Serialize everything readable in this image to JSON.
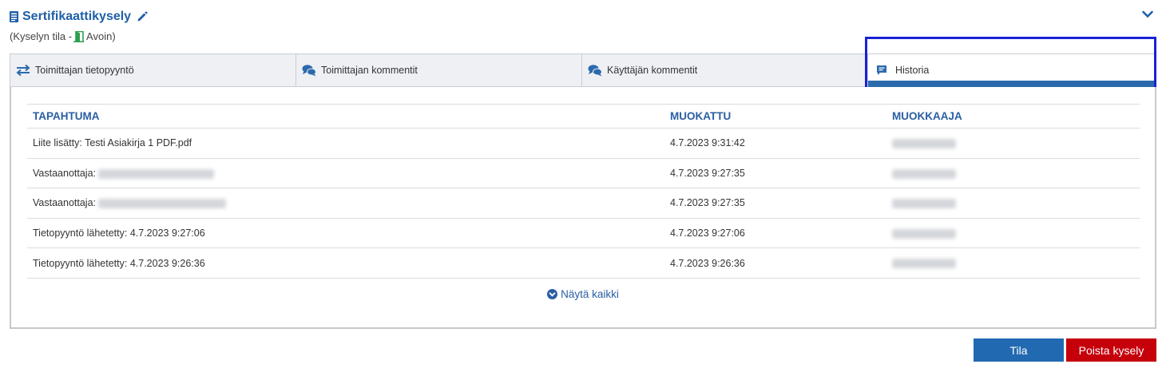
{
  "header": {
    "title": "Sertifikaattikysely",
    "status_prefix": "(Kyselyn tila -",
    "status_value": "Avoin)"
  },
  "tabs": [
    {
      "label": "Toimittajan tietopyyntö",
      "icon": "exchange-arrows-icon",
      "active": false
    },
    {
      "label": "Toimittajan kommentit",
      "icon": "comments-icon",
      "active": false
    },
    {
      "label": "Käyttäjän kommentit",
      "icon": "comments-icon",
      "active": false
    },
    {
      "label": "Historia",
      "icon": "message-icon",
      "active": true
    }
  ],
  "table": {
    "columns": [
      "TAPAHTUMA",
      "MUOKATTU",
      "MUOKKAAJA"
    ],
    "rows": [
      {
        "event": "Liite lisätty: Testi Asiakirja 1 PDF.pdf",
        "modified": "4.7.2023 9:31:42"
      },
      {
        "event": "Vastaanottaja:",
        "modified": "4.7.2023 9:27:35"
      },
      {
        "event": "Vastaanottaja:",
        "modified": "4.7.2023 9:27:35"
      },
      {
        "event": "Tietopyyntö lähetetty: 4.7.2023 9:27:06",
        "modified": "4.7.2023 9:27:06"
      },
      {
        "event": "Tietopyyntö lähetetty: 4.7.2023 9:26:36",
        "modified": "4.7.2023 9:26:36"
      }
    ]
  },
  "show_all": "Näytä kaikki",
  "buttons": {
    "status": "Tila",
    "delete": "Poista kysely"
  },
  "colors": {
    "accent": "#2169b0",
    "danger": "#c5000b",
    "status_green": "#2e9e4f",
    "highlight": "#1a22d4"
  }
}
